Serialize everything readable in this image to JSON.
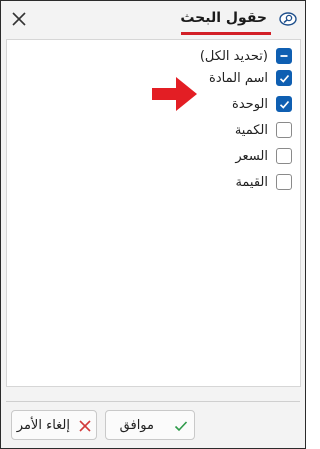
{
  "window": {
    "title": "حقول البحث",
    "icon": "search-window-icon",
    "close_icon": "close-icon",
    "accent_color": "#d21f26"
  },
  "fields": [
    {
      "label": "(تحديد الكل)",
      "state": "indeterminate"
    },
    {
      "label": "اسم المادة",
      "state": "checked"
    },
    {
      "label": "الوحدة",
      "state": "checked"
    },
    {
      "label": "الكمية",
      "state": "unchecked"
    },
    {
      "label": "السعر",
      "state": "unchecked"
    },
    {
      "label": "القيمة",
      "state": "unchecked"
    }
  ],
  "annotation": {
    "icon": "red-arrow-icon",
    "color": "#e31e24"
  },
  "buttons": {
    "ok_label": "موافق",
    "ok_icon": "check-icon",
    "cancel_label": "إلغاء الأمر",
    "cancel_icon": "x-icon",
    "checkbox_color": "#0f5fb2"
  }
}
